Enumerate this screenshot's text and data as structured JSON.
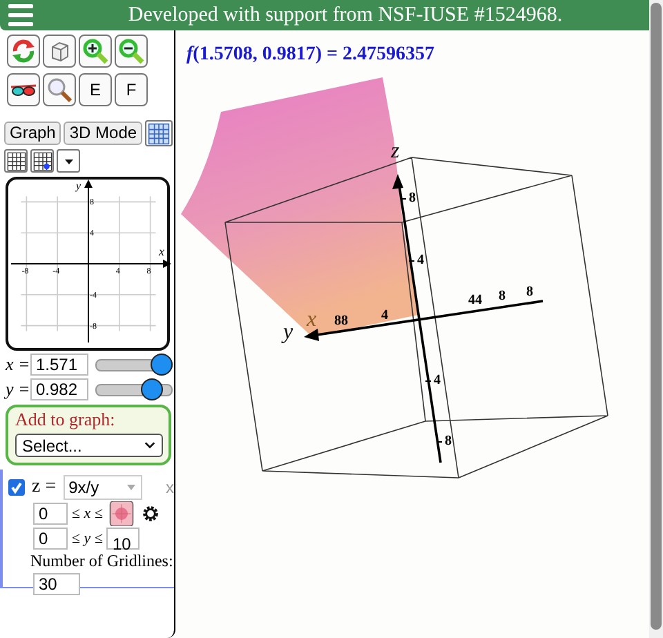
{
  "banner": {
    "text": "Developed with support from NSF-IUSE #1524968."
  },
  "tool_letters": [
    "E",
    "F"
  ],
  "mode_buttons": [
    "Graph",
    "3D Mode"
  ],
  "mini_graph": {
    "x_label": "x",
    "y_label": "y",
    "x_ticks": [
      "-8",
      "-4",
      "4",
      "8"
    ],
    "y_ticks": [
      "8",
      "4",
      "-4",
      "-8"
    ]
  },
  "sliders": [
    {
      "name": "x =",
      "value": "1.571",
      "level": 0.86
    },
    {
      "name": "y =",
      "value": "0.982",
      "level": 0.74
    }
  ],
  "add_to_graph": {
    "label": "Add to graph:",
    "select": "Select..."
  },
  "expression": {
    "checked": true,
    "variable": "z =",
    "formula": "9x/y",
    "close": "x",
    "x_min": "0",
    "x_op": "≤ *x* ≤",
    "y_min": "0",
    "y_op": "≤ *y* ≤",
    "y_max": "10",
    "gridlines_label": "Number of Gridlines:",
    "gridlines": "30"
  },
  "result": {
    "text": "*f*(1.5708, 0.9817) = 2.47596357"
  },
  "plot3d": {
    "axis_labels": [
      "z",
      "y",
      "x"
    ],
    "tick_labels": [
      "8",
      "4",
      "4",
      "8",
      "88",
      "4",
      "44",
      "8",
      "8"
    ]
  }
}
